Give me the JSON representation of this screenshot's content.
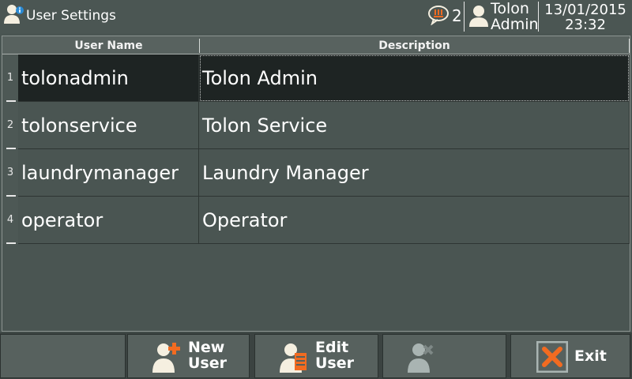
{
  "header": {
    "title": "User Settings",
    "alarm_count": "2",
    "user_first": "Tolon",
    "user_second": "Admin",
    "date": "13/01/2015",
    "time": "23:32"
  },
  "table": {
    "columns": [
      "User Name",
      "Description"
    ],
    "rows": [
      {
        "num": "1",
        "username": "tolonadmin",
        "description": "Tolon Admin",
        "selected": true
      },
      {
        "num": "2",
        "username": "tolonservice",
        "description": "Tolon Service",
        "selected": false
      },
      {
        "num": "3",
        "username": "laundrymanager",
        "description": "Laundry Manager",
        "selected": false
      },
      {
        "num": "4",
        "username": "operator",
        "description": "Operator",
        "selected": false
      }
    ]
  },
  "toolbar": {
    "new_user_line1": "New",
    "new_user_line2": "User",
    "edit_user_line1": "Edit",
    "edit_user_line2": "User",
    "exit_label": "Exit"
  },
  "icons": {
    "title": "user-info-icon",
    "alarm": "alarm-speech-bubble-icon",
    "user": "person-icon",
    "new_user": "user-plus-icon",
    "edit_user": "user-edit-icon",
    "delete_user": "user-delete-icon",
    "exit": "exit-x-icon"
  },
  "colors": {
    "background": "#4a5552",
    "selected_row": "#1e2423",
    "accent_orange": "#f26b21",
    "info_blue": "#2a8ad4"
  }
}
